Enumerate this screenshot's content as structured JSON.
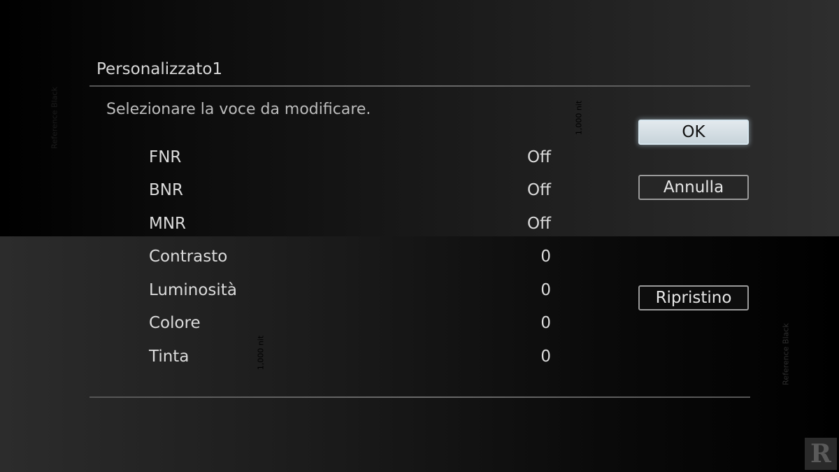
{
  "dialog": {
    "title": "Personalizzato1",
    "instruction": "Selezionare la voce da modificare."
  },
  "watermarks": {
    "reference_black": "Reference Black",
    "nit_label": "1,000 nit"
  },
  "settings": [
    {
      "label": "FNR",
      "value": "Off"
    },
    {
      "label": "BNR",
      "value": "Off"
    },
    {
      "label": "MNR",
      "value": "Off"
    },
    {
      "label": "Contrasto",
      "value": "0"
    },
    {
      "label": "Luminosità",
      "value": "0"
    },
    {
      "label": "Colore",
      "value": "0"
    },
    {
      "label": "Tinta",
      "value": "0"
    }
  ],
  "buttons": {
    "ok": "OK",
    "cancel": "Annulla",
    "reset": "Ripristino"
  },
  "logo": {
    "letter": "R"
  },
  "colors": {
    "focus_button_bg": "#d3dde3",
    "text": "#dcdcdc"
  }
}
